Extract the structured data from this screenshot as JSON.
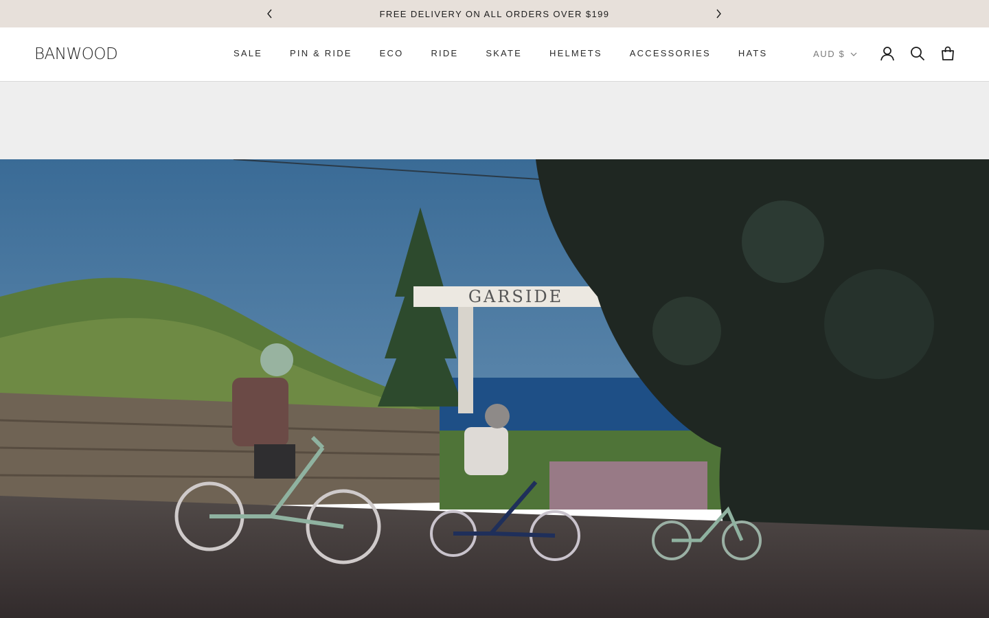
{
  "announcement": {
    "text": "FREE DELIVERY ON ALL ORDERS OVER $199",
    "prev_icon": "chevron-left-icon",
    "next_icon": "chevron-right-icon"
  },
  "header": {
    "logo": "BANWOOD",
    "nav": [
      {
        "label": "SALE"
      },
      {
        "label": "PIN & RIDE"
      },
      {
        "label": "ECO"
      },
      {
        "label": "RIDE"
      },
      {
        "label": "SKATE"
      },
      {
        "label": "HELMETS"
      },
      {
        "label": "ACCESSORIES"
      },
      {
        "label": "HATS"
      }
    ],
    "currency": "AUD $",
    "icons": [
      "account-icon",
      "search-icon",
      "cart-icon"
    ]
  },
  "hero": {
    "sign_text": "GARSIDE",
    "colors": {
      "sky": "#3f6c95",
      "sea": "#1e4f86",
      "tree_dark": "#1f2722",
      "road": "#3f3838"
    }
  }
}
